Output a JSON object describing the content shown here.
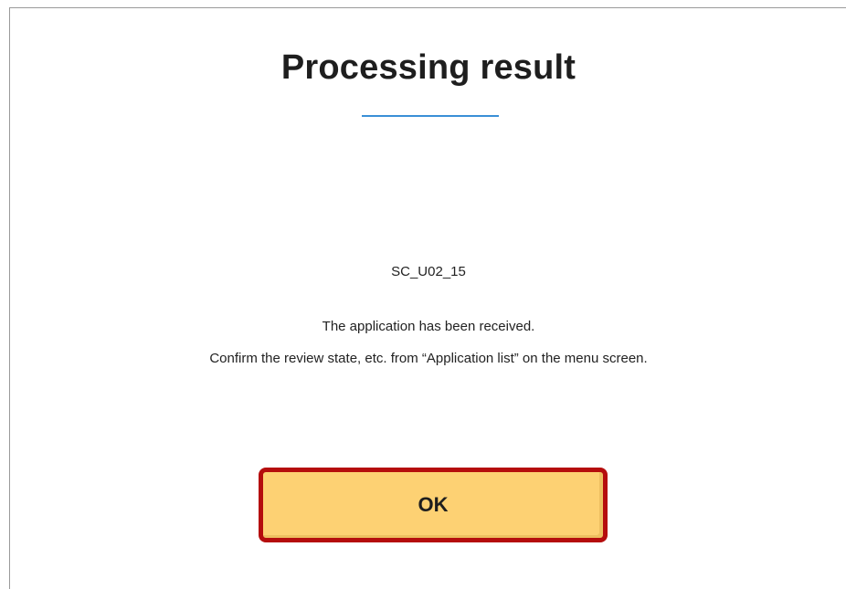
{
  "dialog": {
    "title": "Processing result",
    "screen_id": "SC_U02_15",
    "message_line1": "The application has been received.",
    "message_line2": "Confirm the review state, etc. from “Application list” on the menu screen.",
    "ok_label": "OK"
  },
  "colors": {
    "title_underline": "#3a8fd6",
    "ok_button_fill": "#fdd173",
    "ok_button_highlight_border": "#b50d0d"
  }
}
